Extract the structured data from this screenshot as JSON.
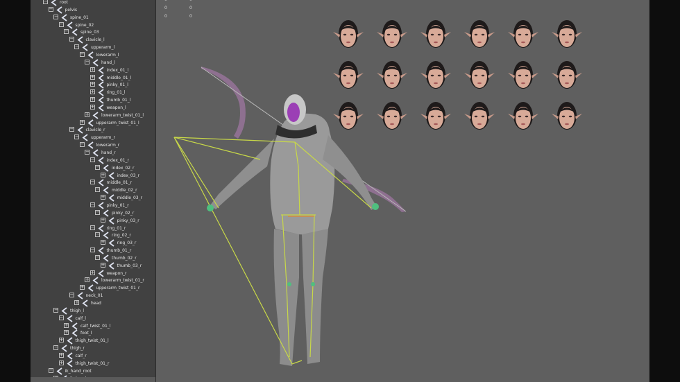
{
  "outliner": {
    "items": [
      {
        "label": "root",
        "depth": 0
      },
      {
        "label": "pelvis",
        "depth": 1
      },
      {
        "label": "spine_01",
        "depth": 2
      },
      {
        "label": "spine_02",
        "depth": 3
      },
      {
        "label": "spine_03",
        "depth": 4
      },
      {
        "label": "clavicle_l",
        "depth": 5
      },
      {
        "label": "upperarm_l",
        "depth": 6
      },
      {
        "label": "lowerarm_l",
        "depth": 7
      },
      {
        "label": "hand_l",
        "depth": 8
      },
      {
        "label": "index_01_l",
        "depth": 9
      },
      {
        "label": "middle_01_l",
        "depth": 9
      },
      {
        "label": "pinky_01_l",
        "depth": 9
      },
      {
        "label": "ring_01_l",
        "depth": 9
      },
      {
        "label": "thumb_01_l",
        "depth": 9
      },
      {
        "label": "weapon_l",
        "depth": 9
      },
      {
        "label": "lowerarm_twist_01_l",
        "depth": 8
      },
      {
        "label": "upperarm_twist_01_l",
        "depth": 7
      },
      {
        "label": "clavicle_r",
        "depth": 5
      },
      {
        "label": "upperarm_r",
        "depth": 6
      },
      {
        "label": "lowerarm_r",
        "depth": 7
      },
      {
        "label": "hand_r",
        "depth": 8
      },
      {
        "label": "index_01_r",
        "depth": 9
      },
      {
        "label": "index_02_r",
        "depth": 10
      },
      {
        "label": "index_03_r",
        "depth": 11
      },
      {
        "label": "middle_01_r",
        "depth": 9
      },
      {
        "label": "middle_02_r",
        "depth": 10
      },
      {
        "label": "middle_03_r",
        "depth": 11
      },
      {
        "label": "pinky_01_r",
        "depth": 9
      },
      {
        "label": "pinky_02_r",
        "depth": 10
      },
      {
        "label": "pinky_03_r",
        "depth": 11
      },
      {
        "label": "ring_01_r",
        "depth": 9
      },
      {
        "label": "ring_02_r",
        "depth": 10
      },
      {
        "label": "ring_03_r",
        "depth": 11
      },
      {
        "label": "thumb_01_r",
        "depth": 9
      },
      {
        "label": "thumb_02_r",
        "depth": 10
      },
      {
        "label": "thumb_03_r",
        "depth": 11
      },
      {
        "label": "weapon_r",
        "depth": 9
      },
      {
        "label": "lowerarm_twist_01_r",
        "depth": 8
      },
      {
        "label": "upperarm_twist_01_r",
        "depth": 7
      },
      {
        "label": "neck_01",
        "depth": 5
      },
      {
        "label": "head",
        "depth": 6
      },
      {
        "label": "thigh_l",
        "depth": 2
      },
      {
        "label": "calf_l",
        "depth": 3
      },
      {
        "label": "calf_twist_01_l",
        "depth": 4
      },
      {
        "label": "foot_l",
        "depth": 4
      },
      {
        "label": "thigh_twist_01_l",
        "depth": 3
      },
      {
        "label": "thigh_r",
        "depth": 2
      },
      {
        "label": "calf_r",
        "depth": 3
      },
      {
        "label": "thigh_twist_01_r",
        "depth": 3
      },
      {
        "label": "ik_hand_root",
        "depth": 1
      },
      {
        "label": "ik_hand_gun",
        "depth": 2
      }
    ]
  },
  "hud": {
    "col1": [
      "0",
      "0",
      "0"
    ],
    "col2": [
      "0",
      "0",
      "0"
    ]
  },
  "viewport": {
    "background": "#5f5f5f",
    "joint_color": "#c8d848",
    "face_rows": 3,
    "face_cols": 6
  }
}
